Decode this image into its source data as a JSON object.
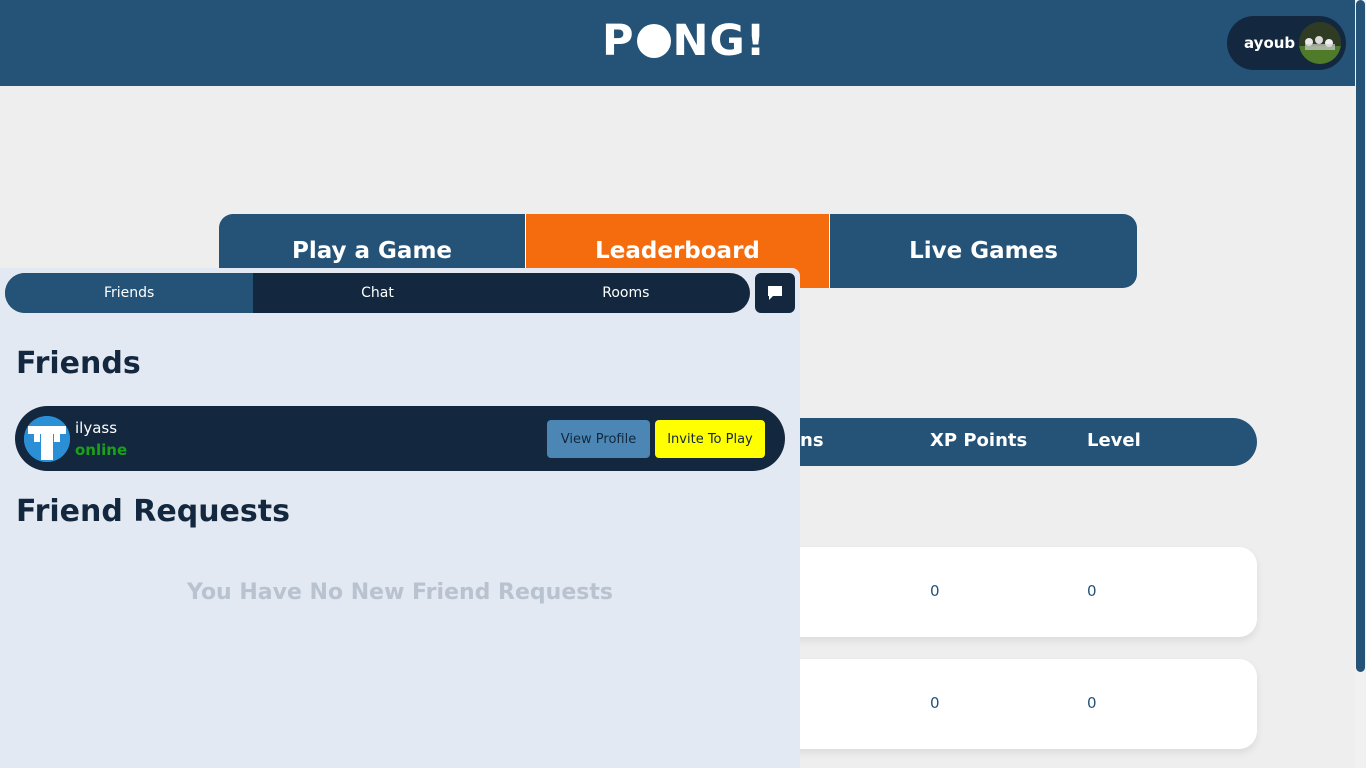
{
  "header": {
    "logo_text_left": "P",
    "logo_text_right": "NG!",
    "username": "ayoub",
    "colors": {
      "bar": "#245377",
      "chip": "#13283e"
    }
  },
  "main_tabs": [
    {
      "label": "Play a Game"
    },
    {
      "label": "Leaderboard",
      "active": true
    },
    {
      "label": "Live Games"
    }
  ],
  "leaderboard": {
    "headers": {
      "wins_partial": "ns",
      "xp": "XP Points",
      "level": "Level"
    },
    "rows": [
      {
        "xp": "0",
        "level": "0"
      },
      {
        "xp": "0",
        "level": "0"
      }
    ]
  },
  "panel": {
    "tabs": [
      {
        "label": "Friends",
        "active": true
      },
      {
        "label": "Chat"
      },
      {
        "label": "Rooms"
      }
    ],
    "message_icon": "message-icon",
    "friends_heading": "Friends",
    "friends": [
      {
        "name": "ilyass",
        "status": "online",
        "view_label": "View Profile",
        "invite_label": "Invite To Play"
      }
    ],
    "requests_heading": "Friend Requests",
    "requests_empty": "You Have No New Friend Requests"
  },
  "accent_colors": {
    "active_tab": "#f56c0f",
    "invite": "#ffff00",
    "online": "#1aa01a"
  }
}
